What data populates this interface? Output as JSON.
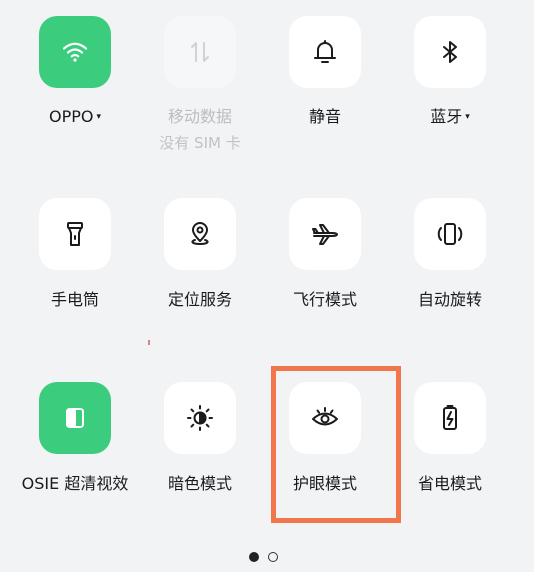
{
  "quick_settings": {
    "wifi": {
      "label": "OPPO",
      "caret": "▾",
      "icon": "wifi-icon",
      "state": "on"
    },
    "mobile_data": {
      "label": "移动数据",
      "sublabel": "没有 SIM 卡",
      "icon": "mobile-data-arrows-icon",
      "state": "disabled"
    },
    "mute": {
      "label": "静音",
      "icon": "bell-icon",
      "state": "off"
    },
    "bluetooth": {
      "label": "蓝牙",
      "caret": "▾",
      "icon": "bluetooth-icon",
      "state": "off"
    },
    "flashlight": {
      "label": "手电筒",
      "icon": "flashlight-icon",
      "state": "off"
    },
    "location": {
      "label": "定位服务",
      "icon": "location-pin-icon",
      "state": "off"
    },
    "airplane": {
      "label": "飞行模式",
      "icon": "airplane-icon",
      "state": "off"
    },
    "auto_rotate": {
      "label": "自动旋转",
      "icon": "rotate-phone-icon",
      "state": "off"
    },
    "osie": {
      "label": "OSIE 超清视效",
      "icon": "osie-display-icon",
      "state": "on"
    },
    "dark_mode": {
      "label": "暗色模式",
      "icon": "dark-mode-sun-icon",
      "state": "off"
    },
    "eye_comfort": {
      "label": "护眼模式",
      "icon": "eye-icon",
      "state": "off",
      "highlighted": true
    },
    "power_saving": {
      "label": "省电模式",
      "icon": "battery-bolt-icon",
      "state": "off"
    }
  },
  "pagination": {
    "pages": 2,
    "current": 1
  },
  "colors": {
    "active_tile": "#3ccc7d",
    "highlight_border": "#f0774b",
    "background": "#f2f3f5"
  }
}
